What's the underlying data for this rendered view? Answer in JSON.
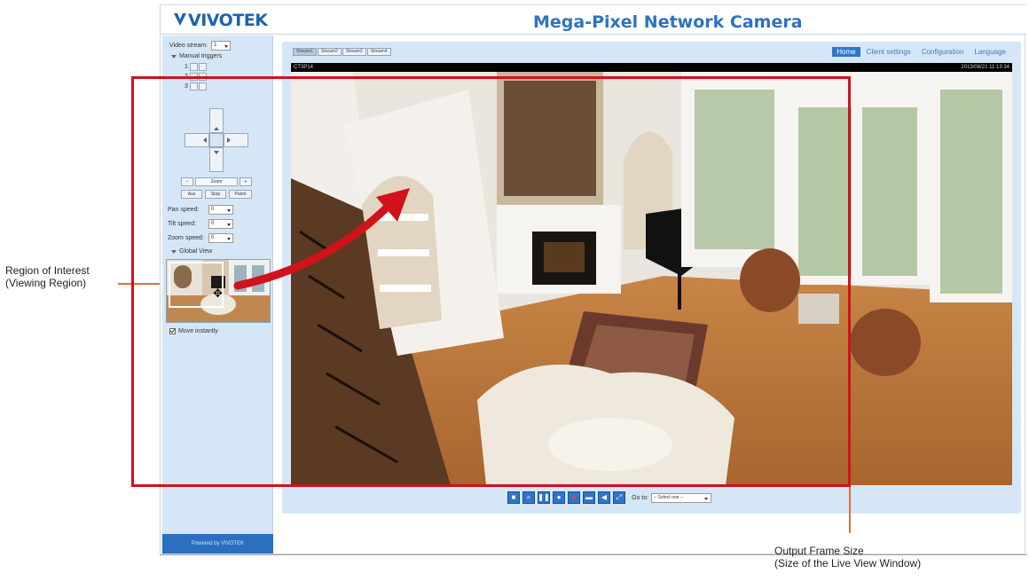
{
  "annotations": {
    "roi_line1": "Region of Interest",
    "roi_line2": "(Viewing Region)",
    "output_line1": "Output Frame Size",
    "output_line2": "(Size of the Live View Window)",
    "accent_color": "#e0703c",
    "arrow_color": "#d0121b"
  },
  "header": {
    "logo": "VIVOTEK",
    "title": "Mega-Pixel Network Camera"
  },
  "sidebar": {
    "video_stream_label": "Video stream:",
    "video_stream_value": "1",
    "manual_triggers_label": "Manual triggers",
    "trigger_rows": [
      "1",
      "2",
      "3"
    ],
    "zoom_label": "Zoom",
    "preset_buttons": [
      "Aux",
      "Stop",
      "Patrol"
    ],
    "pan_speed_label": "Pan speed:",
    "pan_speed_value": "0",
    "tilt_speed_label": "Tilt speed:",
    "tilt_speed_value": "0",
    "zoom_speed_label": "Zoom speed:",
    "zoom_speed_value": "0",
    "global_view_label": "Global View",
    "move_instantly_label": "Move instantly",
    "powered_by": "Powered by VIVOTEK"
  },
  "main": {
    "stream_tabs": [
      "Stream1",
      "Stream2",
      "Stream3",
      "Stream4"
    ],
    "nav": [
      {
        "label": "Home",
        "active": true
      },
      {
        "label": "Client settings",
        "active": false
      },
      {
        "label": "Configuration",
        "active": false
      },
      {
        "label": "Language",
        "active": false
      }
    ],
    "camera_name": "CT3P14",
    "timestamp": "2013/08/21 11:13:34",
    "goto_label": "Go to:",
    "goto_placeholder": "-- Select one --",
    "control_icons": [
      "snapshot-icon",
      "digital-zoom-icon",
      "pause-icon",
      "stop-icon",
      "record-icon",
      "volume-icon",
      "mute-icon",
      "fullscreen-icon"
    ]
  }
}
